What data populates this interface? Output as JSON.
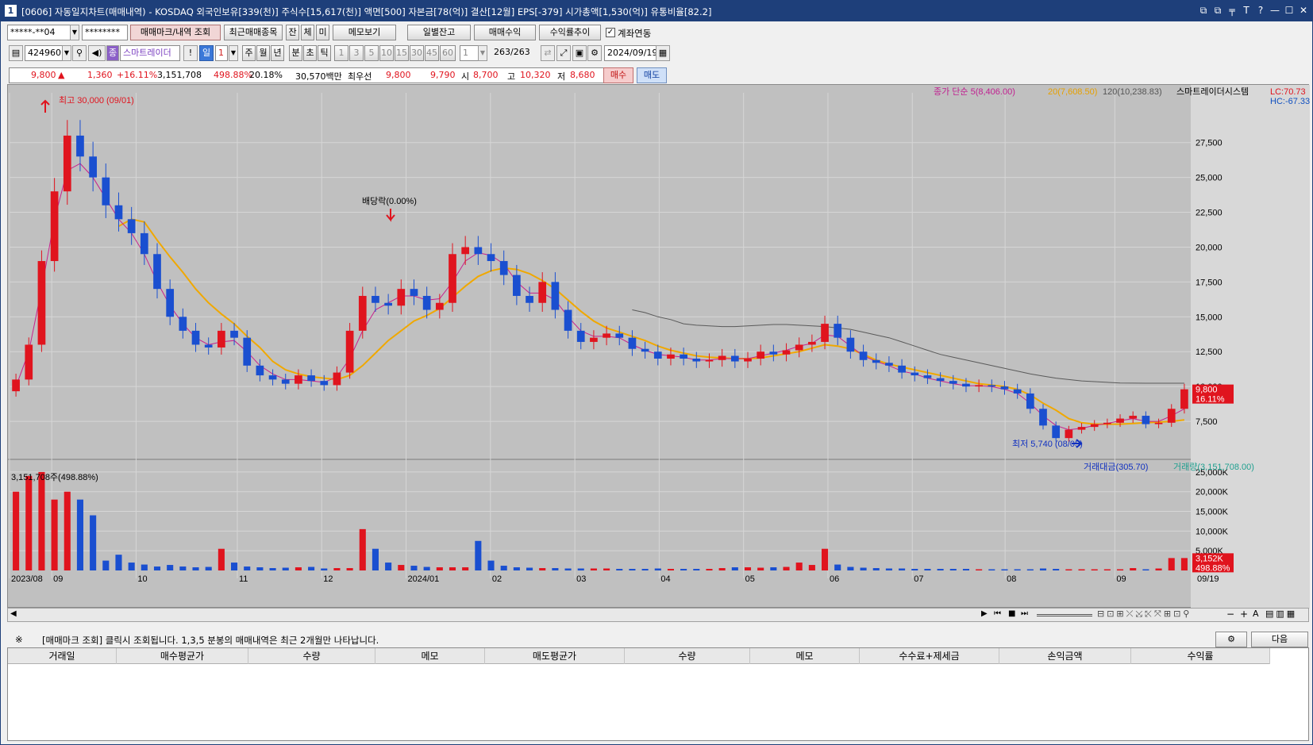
{
  "window": {
    "num": "1",
    "title": "[0606] 자동일지차트(매매내역) - KOSDAQ 외국인보유[339(천)] 주식수[15,617(천)] 액면[500] 자본금[78(억)] 결산[12월] EPS[-379] 시가총액[1,530(억)] 유통비율[82.2]",
    "buttons": [
      "⧉",
      "⧉",
      "╤",
      "T",
      "?",
      "—",
      "☐",
      "✕"
    ]
  },
  "toolbar1": {
    "account": "*****-**04",
    "password": "********",
    "btn_trade_mark": "매매마크/내역 조회",
    "btn_recent": "최근매매종목",
    "btn_jan": "잔",
    "btn_che": "체",
    "btn_mi": "미",
    "btn_memo": "메모보기",
    "btn_daily": "일별잔고",
    "btn_profit": "매매수익",
    "btn_profit_trend": "수익률추이",
    "chk_account_link": "계좌연동"
  },
  "toolbar2": {
    "code": "424960",
    "smart": "스마트레이더",
    "excl": "!",
    "period_active": "일",
    "period_num": "1",
    "periods": [
      "주",
      "월",
      "년",
      "분",
      "초",
      "틱"
    ],
    "minutes": [
      "1",
      "3",
      "5",
      "10",
      "15",
      "30",
      "45",
      "60"
    ],
    "min_sel": "1",
    "count": "263",
    "count_total": "/263",
    "date": "2024/09/19"
  },
  "quote": {
    "price": "9,800",
    "arrow": "▲",
    "change": "1,360",
    "rate": "+16.11%",
    "volume": "3,151,708",
    "vol_rate": "498.88%",
    "turnover": "20.18%",
    "amount": "30,570백만",
    "best": "최우선",
    "best_ask": "9,800",
    "best_bid": "9,790",
    "open_lbl": "시",
    "open": "8,700",
    "high_lbl": "고",
    "high": "10,320",
    "low_lbl": "저",
    "low": "8,680",
    "buy": "매수",
    "sell": "매도"
  },
  "chart_data": {
    "type": "candlestick",
    "title": "",
    "ylabel": "",
    "ylim": [
      5000,
      30500
    ],
    "price_ticks": [
      "7,500",
      "10,000",
      "12,500",
      "15,000",
      "17,500",
      "20,000",
      "22,500",
      "25,000",
      "27,500"
    ],
    "price_tick_values": [
      7500,
      10000,
      12500,
      15000,
      17500,
      20000,
      22500,
      25000,
      27500
    ],
    "legend": {
      "close": "종가 단순 5(8,406.00)",
      "ma20": "20(7,608.50)",
      "ma120": "120(10,238.83)",
      "vendor": "스마트레이더시스템"
    },
    "lc": "LC:70.73",
    "hc": "HC:-67.33",
    "high_annot": "최고 30,000 (09/01)",
    "low_annot": "최저 5,740 (08/05)",
    "dividend_annot": "배당락(0.00%)",
    "current_price_label": "9,800",
    "current_rate_label": "16.11%",
    "x_labels": [
      "2023/08",
      "09",
      "10",
      "11",
      "12",
      "2024/01",
      "02",
      "03",
      "04",
      "05",
      "06",
      "07",
      "08",
      "09"
    ],
    "x_last": "09/19",
    "close_series": [
      10500,
      13000,
      19000,
      24000,
      28000,
      26500,
      25000,
      23000,
      22000,
      21000,
      19500,
      17000,
      15000,
      14000,
      13000,
      12800,
      14000,
      13500,
      11500,
      10800,
      10500,
      10200,
      10800,
      10400,
      10100,
      11000,
      14000,
      16500,
      16000,
      15800,
      17000,
      16500,
      15500,
      16000,
      19500,
      20000,
      19500,
      19000,
      18000,
      16500,
      16000,
      17500,
      15500,
      14000,
      13200,
      13500,
      13800,
      13500,
      12700,
      12500,
      12000,
      12300,
      12000,
      11800,
      11900,
      12200,
      11800,
      12000,
      12500,
      12300,
      12600,
      13000,
      13200,
      14500,
      13500,
      12500,
      11900,
      11700,
      11500,
      11000,
      10800,
      10600,
      10400,
      10200,
      10000,
      10100,
      10000,
      9800,
      9500,
      8400,
      7200,
      6300,
      6900,
      7100,
      7300,
      7400,
      7700,
      7900,
      7300,
      7400,
      8400,
      9800
    ],
    "ma5": [
      10000,
      12500,
      17000,
      22000,
      25500,
      26000,
      25000,
      23500,
      22000,
      21000,
      19500,
      17500,
      15800,
      14500,
      13500,
      13000,
      13200,
      13300,
      12500,
      11500,
      10900,
      10500,
      10500,
      10400,
      10300,
      10700,
      12000,
      14000,
      15500,
      16000,
      16500,
      16500,
      16200,
      16300,
      17500,
      19000,
      19600,
      19400,
      18800,
      17500,
      16700,
      16700,
      16200,
      15000,
      14000,
      13600,
      13600,
      13500,
      13000,
      12600,
      12300,
      12200,
      12100,
      11900,
      11900,
      12000,
      12000,
      12000,
      12200,
      12400,
      12600,
      12900,
      13100,
      13700,
      13600,
      12900,
      12200,
      11800,
      11500,
      11100,
      10900,
      10600,
      10400,
      10200,
      10050,
      10050,
      10000,
      9800,
      9500,
      8800,
      7900,
      7200,
      6900,
      7000,
      7200,
      7350,
      7550,
      7700,
      7500,
      7500,
      7900,
      8400
    ],
    "ma20": [
      null,
      null,
      null,
      null,
      null,
      null,
      null,
      null,
      21500,
      22000,
      21800,
      20500,
      19300,
      18200,
      17000,
      16000,
      15200,
      14500,
      13600,
      12800,
      11800,
      11200,
      10900,
      10700,
      10600,
      10500,
      10800,
      11500,
      12400,
      13300,
      14000,
      14700,
      15100,
      15600,
      16400,
      17200,
      17900,
      18300,
      18500,
      18400,
      18100,
      17600,
      17000,
      16200,
      15400,
      14700,
      14200,
      13900,
      13600,
      13300,
      12900,
      12600,
      12400,
      12200,
      12100,
      12050,
      12000,
      12000,
      12050,
      12200,
      12350,
      12500,
      12750,
      13000,
      12900,
      12700,
      12300,
      11900,
      11600,
      11400,
      11200,
      11000,
      10800,
      10600,
      10400,
      10200,
      10100,
      10000,
      9800,
      9400,
      8800,
      8300,
      7700,
      7400,
      7300,
      7300,
      7300,
      7350,
      7400,
      7450,
      7500,
      7600
    ],
    "ma120": [
      null,
      null,
      null,
      null,
      null,
      null,
      null,
      null,
      null,
      null,
      null,
      null,
      null,
      null,
      null,
      null,
      null,
      null,
      null,
      null,
      null,
      null,
      null,
      null,
      null,
      null,
      null,
      null,
      null,
      null,
      null,
      null,
      null,
      null,
      null,
      null,
      null,
      null,
      null,
      null,
      null,
      null,
      null,
      null,
      null,
      null,
      null,
      null,
      15500,
      15300,
      15000,
      14800,
      14500,
      14400,
      14350,
      14300,
      14300,
      14350,
      14400,
      14450,
      14450,
      14400,
      14350,
      14300,
      14200,
      14100,
      13900,
      13700,
      13500,
      13200,
      12900,
      12600,
      12300,
      12100,
      11900,
      11700,
      11500,
      11300,
      11100,
      10900,
      10750,
      10600,
      10500,
      10400,
      10350,
      10300,
      10250,
      10240,
      10239,
      10238,
      10238,
      10238
    ],
    "volume_ticks": [
      "5,000K",
      "10,000K",
      "15,000K",
      "20,000K",
      "25,000K"
    ],
    "volume_tick_values": [
      5000,
      10000,
      15000,
      20000,
      25000
    ],
    "volume_ylim": [
      0,
      27000
    ],
    "volume_legend": {
      "amount": "거래대금(305.70)",
      "volume": "거래량(3,151,708.00)"
    },
    "volume_annot": "3,151,708주(498.88%)",
    "volume_current_label": "3,152K",
    "volume_current_rate": "498.88%",
    "volume_series": [
      20000,
      24000,
      25000,
      18000,
      20000,
      18000,
      14000,
      2500,
      4000,
      2000,
      1500,
      1000,
      1400,
      1000,
      800,
      900,
      5500,
      2000,
      1000,
      800,
      600,
      700,
      800,
      900,
      500,
      600,
      600,
      10500,
      5500,
      2000,
      1400,
      1200,
      900,
      800,
      800,
      800,
      7500,
      2500,
      1200,
      800,
      700,
      600,
      600,
      500,
      500,
      500,
      500,
      400,
      400,
      400,
      500,
      400,
      400,
      400,
      400,
      600,
      800,
      800,
      700,
      800,
      900,
      2000,
      1400,
      5500,
      1500,
      900,
      700,
      600,
      500,
      500,
      400,
      400,
      400,
      400,
      400,
      300,
      300,
      300,
      300,
      300,
      500,
      400,
      300,
      300,
      300,
      300,
      300,
      600,
      300,
      500,
      3150,
      3152
    ]
  },
  "status": {
    "sym": "※",
    "message": "[매매마크 조회] 클릭시 조회됩니다. 1,3,5 분봉의 매매내역은 최근 2개월만 나타납니다.",
    "next": "다음"
  },
  "grid": {
    "columns": [
      "거래일",
      "매수평균가",
      "수량",
      "메모",
      "매도평균가",
      "수량",
      "메모",
      "수수료+제세금",
      "손익금액",
      "수익률"
    ]
  }
}
